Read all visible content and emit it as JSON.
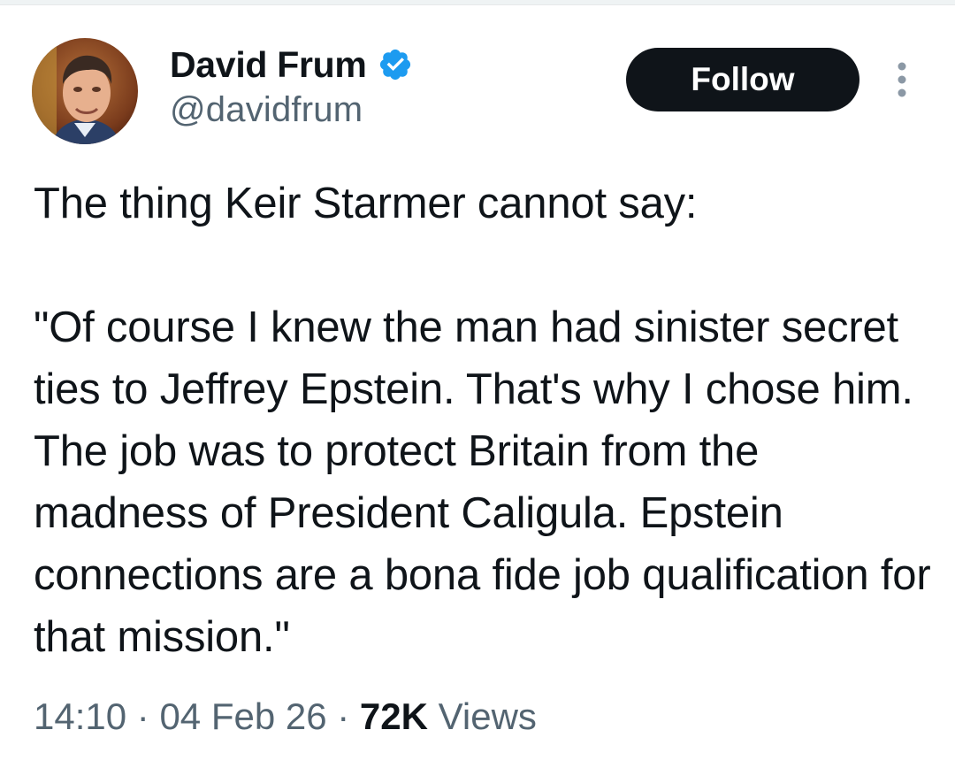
{
  "author": {
    "name": "David Frum",
    "handle": "@davidfrum",
    "verified": true,
    "avatar_icon": "profile-photo"
  },
  "follow_label": "Follow",
  "more_icon": "more-vertical-icon",
  "tweet": {
    "text": "The thing Keir Starmer cannot say:\n\n\"Of course I knew the man had sinister secret ties to Jeffrey Epstein. That's why I chose him. The job was to protect Britain from the madness of President Caligula. Epstein connections are a bona fide job qualification for that mission.\""
  },
  "meta": {
    "time": "14:10",
    "separator": " · ",
    "date": "04 Feb 26",
    "views_count": "72K",
    "views_label": " Views"
  },
  "colors": {
    "text": "#0f1419",
    "secondary": "#536471",
    "verified_blue": "#1d9bf0",
    "button_bg": "#0f1419",
    "button_text": "#ffffff"
  }
}
